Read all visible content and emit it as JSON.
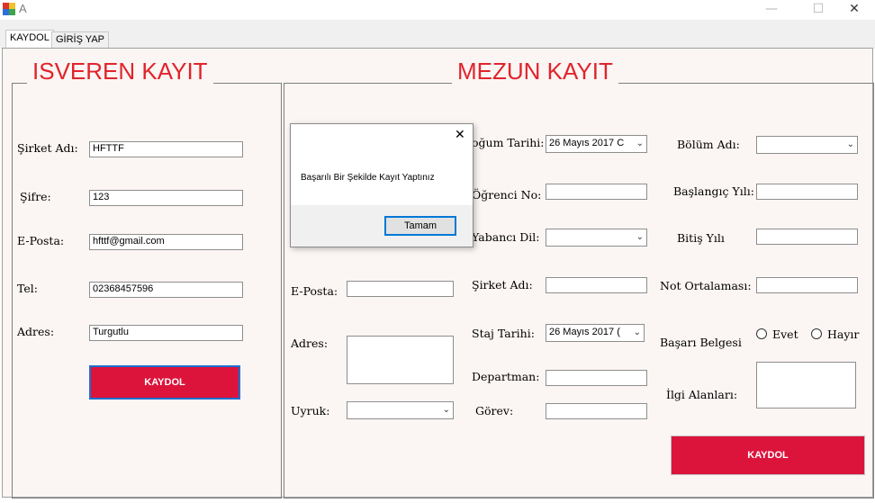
{
  "window": {
    "title": "A",
    "minimize": "—",
    "maximize": "☐",
    "close": "✕"
  },
  "tabs": [
    "KAYDOL",
    "GİRİŞ YAP"
  ],
  "employer": {
    "title": "ISVEREN KAYIT",
    "labels": {
      "company": "Şirket Adı:",
      "password": "Şifre:",
      "email": "E-Posta:",
      "phone": "Tel:",
      "address": "Adres:"
    },
    "values": {
      "company": "HFTTF",
      "password": "123",
      "email": "hfttf@gmail.com",
      "phone": "02368457596",
      "address": "Turgutlu"
    },
    "submit": "KAYDOL"
  },
  "graduate": {
    "title": "MEZUN KAYIT",
    "col1_labels": {
      "email": "E-Posta:",
      "address": "Adres:",
      "nationality": "Uyruk:"
    },
    "col2_labels": {
      "birth_date": "oğum Tarihi:",
      "student_no": "Öğrenci No:",
      "foreign_lang": "Yabancı Dil:",
      "company": "Şirket Adı:",
      "internship_date": "Staj Tarihi:",
      "department": "Departman:",
      "duty": "Görev:"
    },
    "birth_date_value": "26  Mayıs  2017  C",
    "internship_date_value": "26  Mayıs  2017  (",
    "col3_labels": {
      "dept_name": "Bölüm Adı:",
      "start_year": "Başlangıç Yılı:",
      "end_year": "Bitiş Yılı",
      "gpa": "Not Ortalaması:",
      "certificate": "Başarı Belgesi",
      "interests": "İlgi Alanları:"
    },
    "radio_yes": "Evet",
    "radio_no": "Hayır",
    "submit": "KAYDOL"
  },
  "dialog": {
    "message": "Başarılı Bir Şekilde Kayıt Yaptınız",
    "ok": "Tamam",
    "close": "✕"
  },
  "colors": {
    "accent_red": "#dc143c",
    "title_red": "#e0242c",
    "panel_bg": "#fbf5f3",
    "focus_blue": "#0078d7"
  },
  "icons": {
    "app": "winforms-app-icon",
    "dropdown": "chevron-down-icon"
  }
}
